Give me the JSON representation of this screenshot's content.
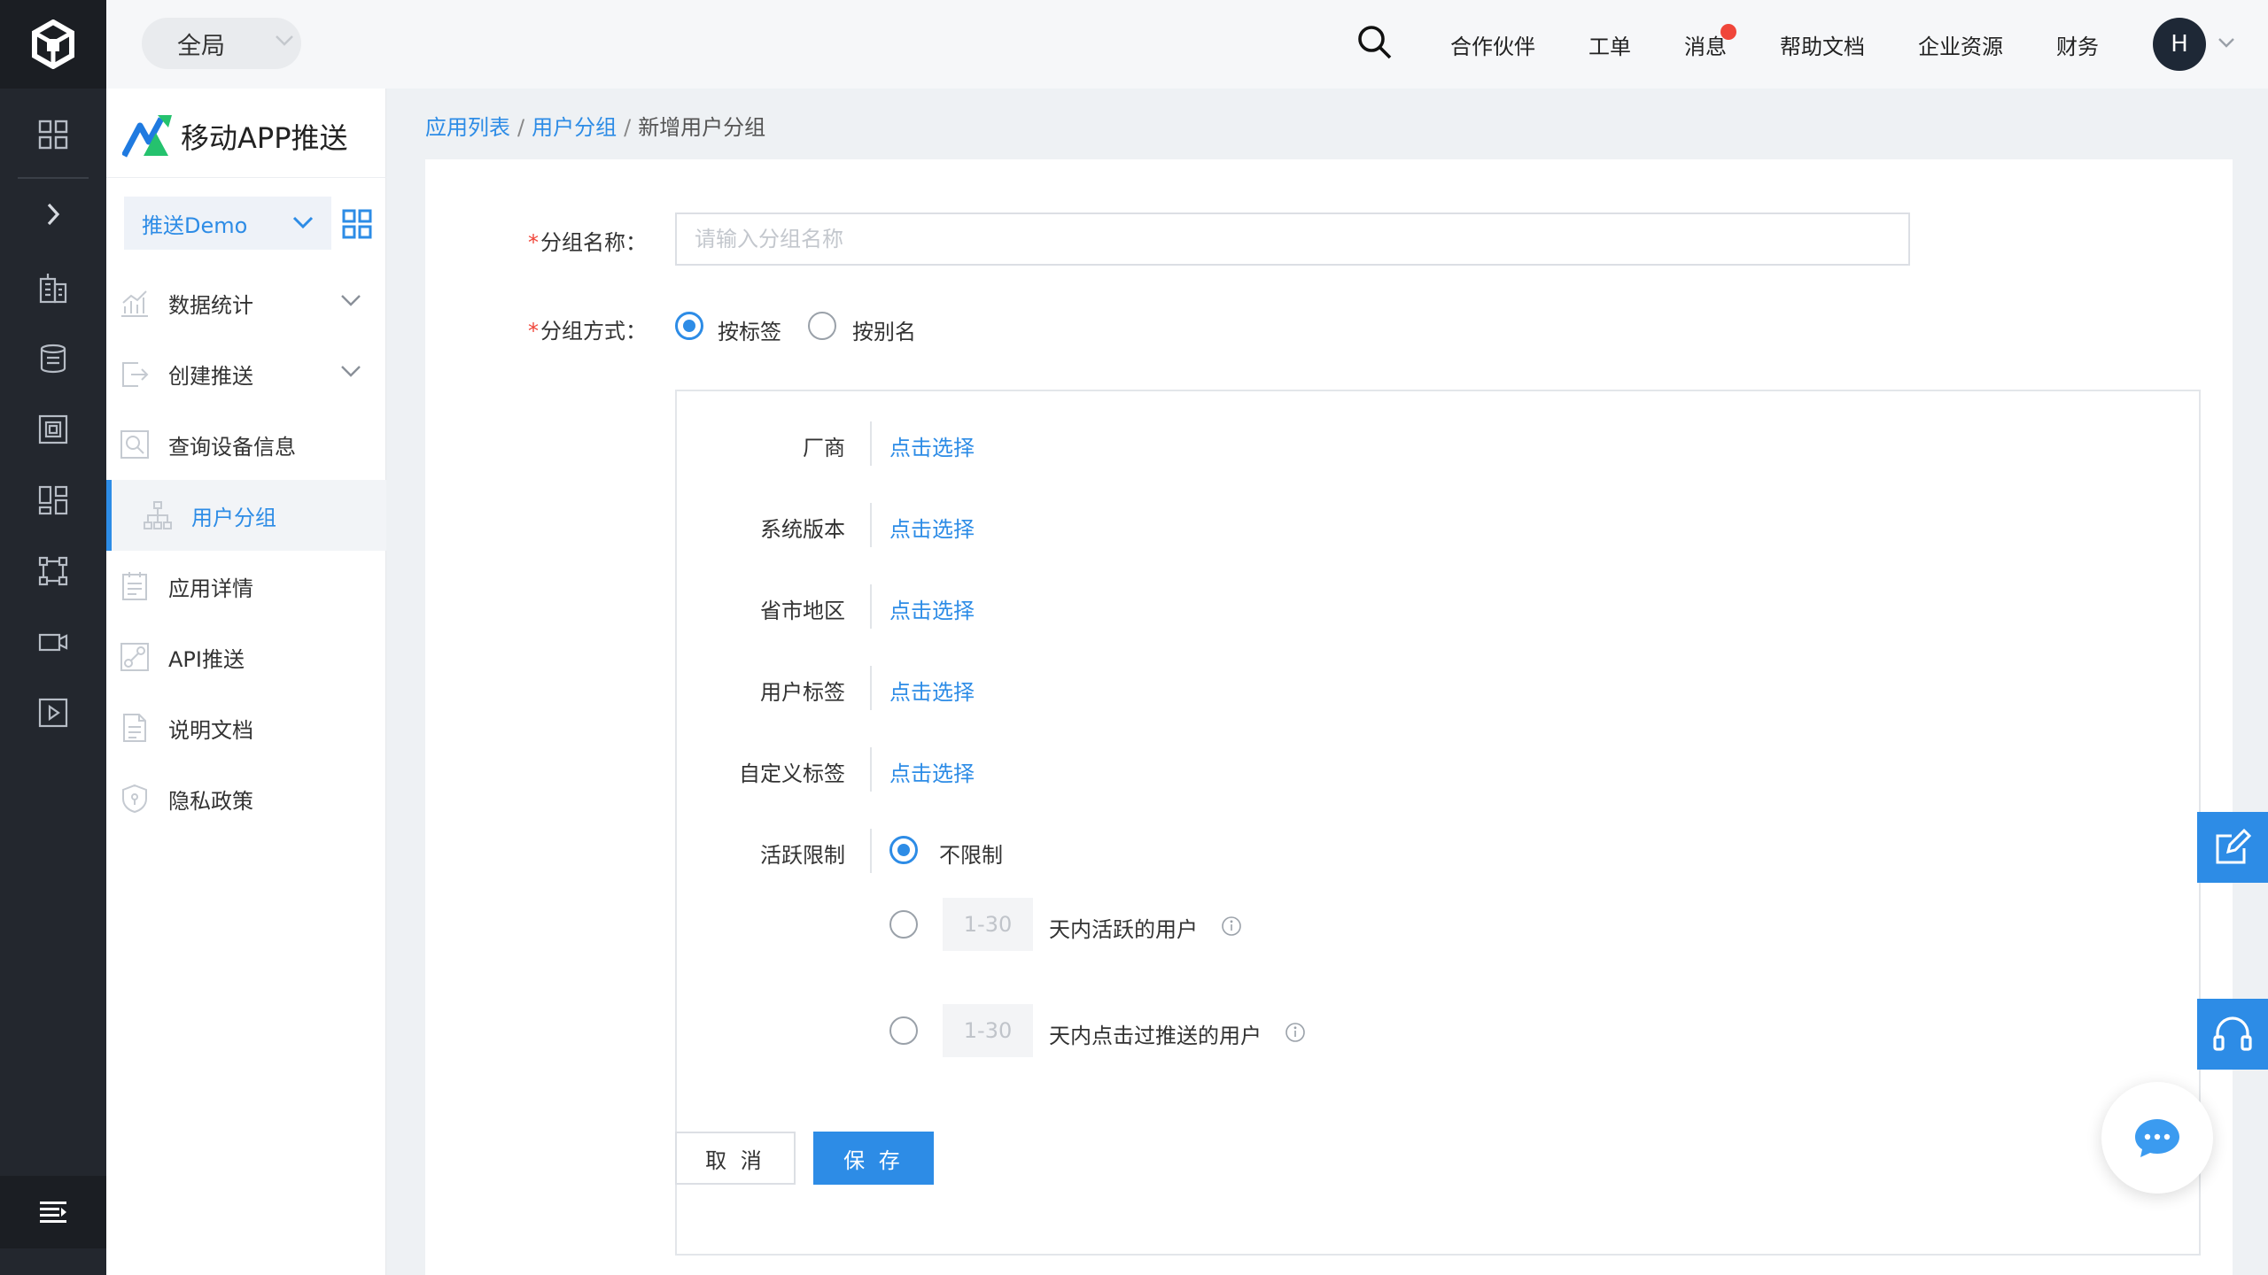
{
  "header": {
    "scope_label": "全局",
    "nav": [
      {
        "id": "partners",
        "label": "合作伙伴"
      },
      {
        "id": "tickets",
        "label": "工单"
      },
      {
        "id": "messages",
        "label": "消息"
      },
      {
        "id": "docs",
        "label": "帮助文档"
      },
      {
        "id": "enterprise",
        "label": "企业资源"
      },
      {
        "id": "finance",
        "label": "财务"
      }
    ],
    "avatar_letter": "H",
    "message_badge_color": "#f0463a"
  },
  "rail": {
    "icons": [
      "apps-grid-icon",
      "expand-chevron-icon",
      "building-icon",
      "database-icon",
      "chip-icon",
      "dashboard-icon",
      "network-icon",
      "camera-icon",
      "play-icon"
    ],
    "bottom_icon": "menu-toggle-icon"
  },
  "sidebar": {
    "product_name": "移动APP推送",
    "app_selected": "推送Demo",
    "items": [
      {
        "label": "数据统计",
        "icon": "chart-icon",
        "expandable": true
      },
      {
        "label": "创建推送",
        "icon": "push-icon",
        "expandable": true
      },
      {
        "label": "查询设备信息",
        "icon": "search-device-icon",
        "expandable": false
      },
      {
        "label": "用户分组",
        "icon": "org-tree-icon",
        "expandable": false,
        "active": true
      },
      {
        "label": "应用详情",
        "icon": "list-doc-icon",
        "expandable": false
      },
      {
        "label": "API推送",
        "icon": "api-icon",
        "expandable": false
      },
      {
        "label": "说明文档",
        "icon": "document-icon",
        "expandable": false
      },
      {
        "label": "隐私政策",
        "icon": "shield-icon",
        "expandable": false
      }
    ]
  },
  "breadcrumb": {
    "items": [
      "应用列表",
      "用户分组",
      "新增用户分组"
    ],
    "separator": "/"
  },
  "form": {
    "name_label": "分组名称：",
    "name_placeholder": "请输入分组名称",
    "name_value": "",
    "method_label": "分组方式：",
    "method_options": [
      "按标签",
      "按别名"
    ],
    "method_selected": "按标签",
    "required_mark": "*",
    "filters": [
      {
        "label": "厂商",
        "action": "点击选择"
      },
      {
        "label": "系统版本",
        "action": "点击选择"
      },
      {
        "label": "省市地区",
        "action": "点击选择"
      },
      {
        "label": "用户标签",
        "action": "点击选择"
      },
      {
        "label": "自定义标签",
        "action": "点击选择"
      }
    ],
    "activity": {
      "label": "活跃限制",
      "options": [
        {
          "text": "不限制",
          "selected": true
        },
        {
          "placeholder": "1-30",
          "text": "天内活跃的用户",
          "selected": false
        },
        {
          "placeholder": "1-30",
          "text": "天内点击过推送的用户",
          "selected": false
        }
      ]
    },
    "cancel_label": "取 消",
    "save_label": "保 存"
  },
  "colors": {
    "accent": "#2d8ce6",
    "rail_bg": "#23272e",
    "required": "#f0463a"
  }
}
